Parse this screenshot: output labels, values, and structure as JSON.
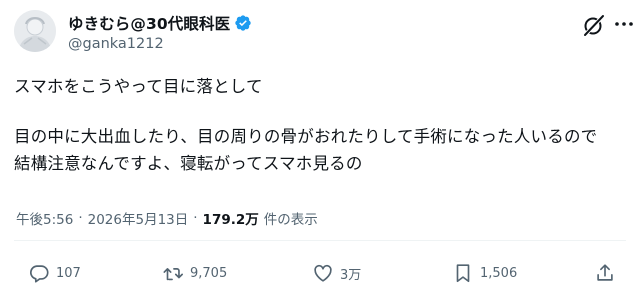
{
  "author": {
    "display_name": "ゆきむら@30代眼科医",
    "handle": "@ganka1212",
    "verified": true,
    "avatar_icon": "avatar-image",
    "verified_color": "#1d9bf0"
  },
  "post": {
    "lines": [
      "スマホをこうやって目に落として",
      "目の中に大出血したり、目の周りの骨がおれたりして手術になった人いるので",
      "結構注意なんですよ、寝転がってスマホ見るの"
    ],
    "time": "午後5:56",
    "separator": "·",
    "date": "2026年5月13日",
    "views_count": "179.2万",
    "views_label": "件の表示"
  },
  "actions": {
    "replies": "107",
    "reposts": "9,705",
    "likes": "3万",
    "bookmarks": "1,506"
  },
  "icons": {
    "grok": "grok-icon",
    "more": "more-icon",
    "reply": "reply-icon",
    "repost": "repost-icon",
    "like": "heart-icon",
    "bookmark": "bookmark-icon",
    "share": "share-icon"
  },
  "colors": {
    "text": "#0f1419",
    "secondary": "#536471",
    "divider": "#eff3f4"
  }
}
